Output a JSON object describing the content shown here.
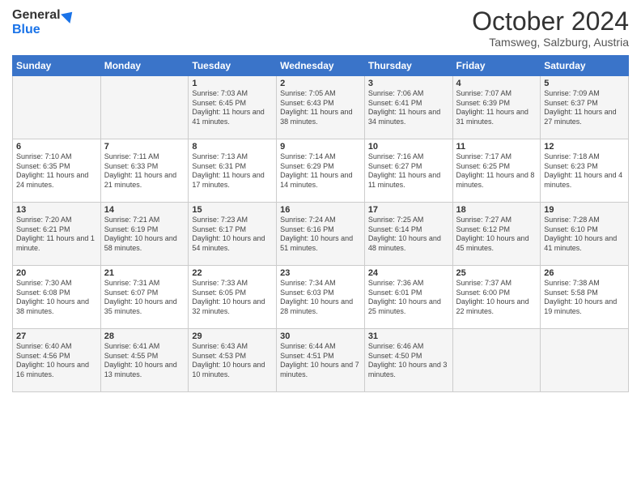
{
  "logo": {
    "line1": "General",
    "line2": "Blue"
  },
  "title": "October 2024",
  "subtitle": "Tamsweg, Salzburg, Austria",
  "days_header": [
    "Sunday",
    "Monday",
    "Tuesday",
    "Wednesday",
    "Thursday",
    "Friday",
    "Saturday"
  ],
  "weeks": [
    [
      {
        "day": "",
        "content": ""
      },
      {
        "day": "",
        "content": ""
      },
      {
        "day": "1",
        "content": "Sunrise: 7:03 AM\nSunset: 6:45 PM\nDaylight: 11 hours and 41 minutes."
      },
      {
        "day": "2",
        "content": "Sunrise: 7:05 AM\nSunset: 6:43 PM\nDaylight: 11 hours and 38 minutes."
      },
      {
        "day": "3",
        "content": "Sunrise: 7:06 AM\nSunset: 6:41 PM\nDaylight: 11 hours and 34 minutes."
      },
      {
        "day": "4",
        "content": "Sunrise: 7:07 AM\nSunset: 6:39 PM\nDaylight: 11 hours and 31 minutes."
      },
      {
        "day": "5",
        "content": "Sunrise: 7:09 AM\nSunset: 6:37 PM\nDaylight: 11 hours and 27 minutes."
      }
    ],
    [
      {
        "day": "6",
        "content": "Sunrise: 7:10 AM\nSunset: 6:35 PM\nDaylight: 11 hours and 24 minutes."
      },
      {
        "day": "7",
        "content": "Sunrise: 7:11 AM\nSunset: 6:33 PM\nDaylight: 11 hours and 21 minutes."
      },
      {
        "day": "8",
        "content": "Sunrise: 7:13 AM\nSunset: 6:31 PM\nDaylight: 11 hours and 17 minutes."
      },
      {
        "day": "9",
        "content": "Sunrise: 7:14 AM\nSunset: 6:29 PM\nDaylight: 11 hours and 14 minutes."
      },
      {
        "day": "10",
        "content": "Sunrise: 7:16 AM\nSunset: 6:27 PM\nDaylight: 11 hours and 11 minutes."
      },
      {
        "day": "11",
        "content": "Sunrise: 7:17 AM\nSunset: 6:25 PM\nDaylight: 11 hours and 8 minutes."
      },
      {
        "day": "12",
        "content": "Sunrise: 7:18 AM\nSunset: 6:23 PM\nDaylight: 11 hours and 4 minutes."
      }
    ],
    [
      {
        "day": "13",
        "content": "Sunrise: 7:20 AM\nSunset: 6:21 PM\nDaylight: 11 hours and 1 minute."
      },
      {
        "day": "14",
        "content": "Sunrise: 7:21 AM\nSunset: 6:19 PM\nDaylight: 10 hours and 58 minutes."
      },
      {
        "day": "15",
        "content": "Sunrise: 7:23 AM\nSunset: 6:17 PM\nDaylight: 10 hours and 54 minutes."
      },
      {
        "day": "16",
        "content": "Sunrise: 7:24 AM\nSunset: 6:16 PM\nDaylight: 10 hours and 51 minutes."
      },
      {
        "day": "17",
        "content": "Sunrise: 7:25 AM\nSunset: 6:14 PM\nDaylight: 10 hours and 48 minutes."
      },
      {
        "day": "18",
        "content": "Sunrise: 7:27 AM\nSunset: 6:12 PM\nDaylight: 10 hours and 45 minutes."
      },
      {
        "day": "19",
        "content": "Sunrise: 7:28 AM\nSunset: 6:10 PM\nDaylight: 10 hours and 41 minutes."
      }
    ],
    [
      {
        "day": "20",
        "content": "Sunrise: 7:30 AM\nSunset: 6:08 PM\nDaylight: 10 hours and 38 minutes."
      },
      {
        "day": "21",
        "content": "Sunrise: 7:31 AM\nSunset: 6:07 PM\nDaylight: 10 hours and 35 minutes."
      },
      {
        "day": "22",
        "content": "Sunrise: 7:33 AM\nSunset: 6:05 PM\nDaylight: 10 hours and 32 minutes."
      },
      {
        "day": "23",
        "content": "Sunrise: 7:34 AM\nSunset: 6:03 PM\nDaylight: 10 hours and 28 minutes."
      },
      {
        "day": "24",
        "content": "Sunrise: 7:36 AM\nSunset: 6:01 PM\nDaylight: 10 hours and 25 minutes."
      },
      {
        "day": "25",
        "content": "Sunrise: 7:37 AM\nSunset: 6:00 PM\nDaylight: 10 hours and 22 minutes."
      },
      {
        "day": "26",
        "content": "Sunrise: 7:38 AM\nSunset: 5:58 PM\nDaylight: 10 hours and 19 minutes."
      }
    ],
    [
      {
        "day": "27",
        "content": "Sunrise: 6:40 AM\nSunset: 4:56 PM\nDaylight: 10 hours and 16 minutes."
      },
      {
        "day": "28",
        "content": "Sunrise: 6:41 AM\nSunset: 4:55 PM\nDaylight: 10 hours and 13 minutes."
      },
      {
        "day": "29",
        "content": "Sunrise: 6:43 AM\nSunset: 4:53 PM\nDaylight: 10 hours and 10 minutes."
      },
      {
        "day": "30",
        "content": "Sunrise: 6:44 AM\nSunset: 4:51 PM\nDaylight: 10 hours and 7 minutes."
      },
      {
        "day": "31",
        "content": "Sunrise: 6:46 AM\nSunset: 4:50 PM\nDaylight: 10 hours and 3 minutes."
      },
      {
        "day": "",
        "content": ""
      },
      {
        "day": "",
        "content": ""
      }
    ]
  ]
}
